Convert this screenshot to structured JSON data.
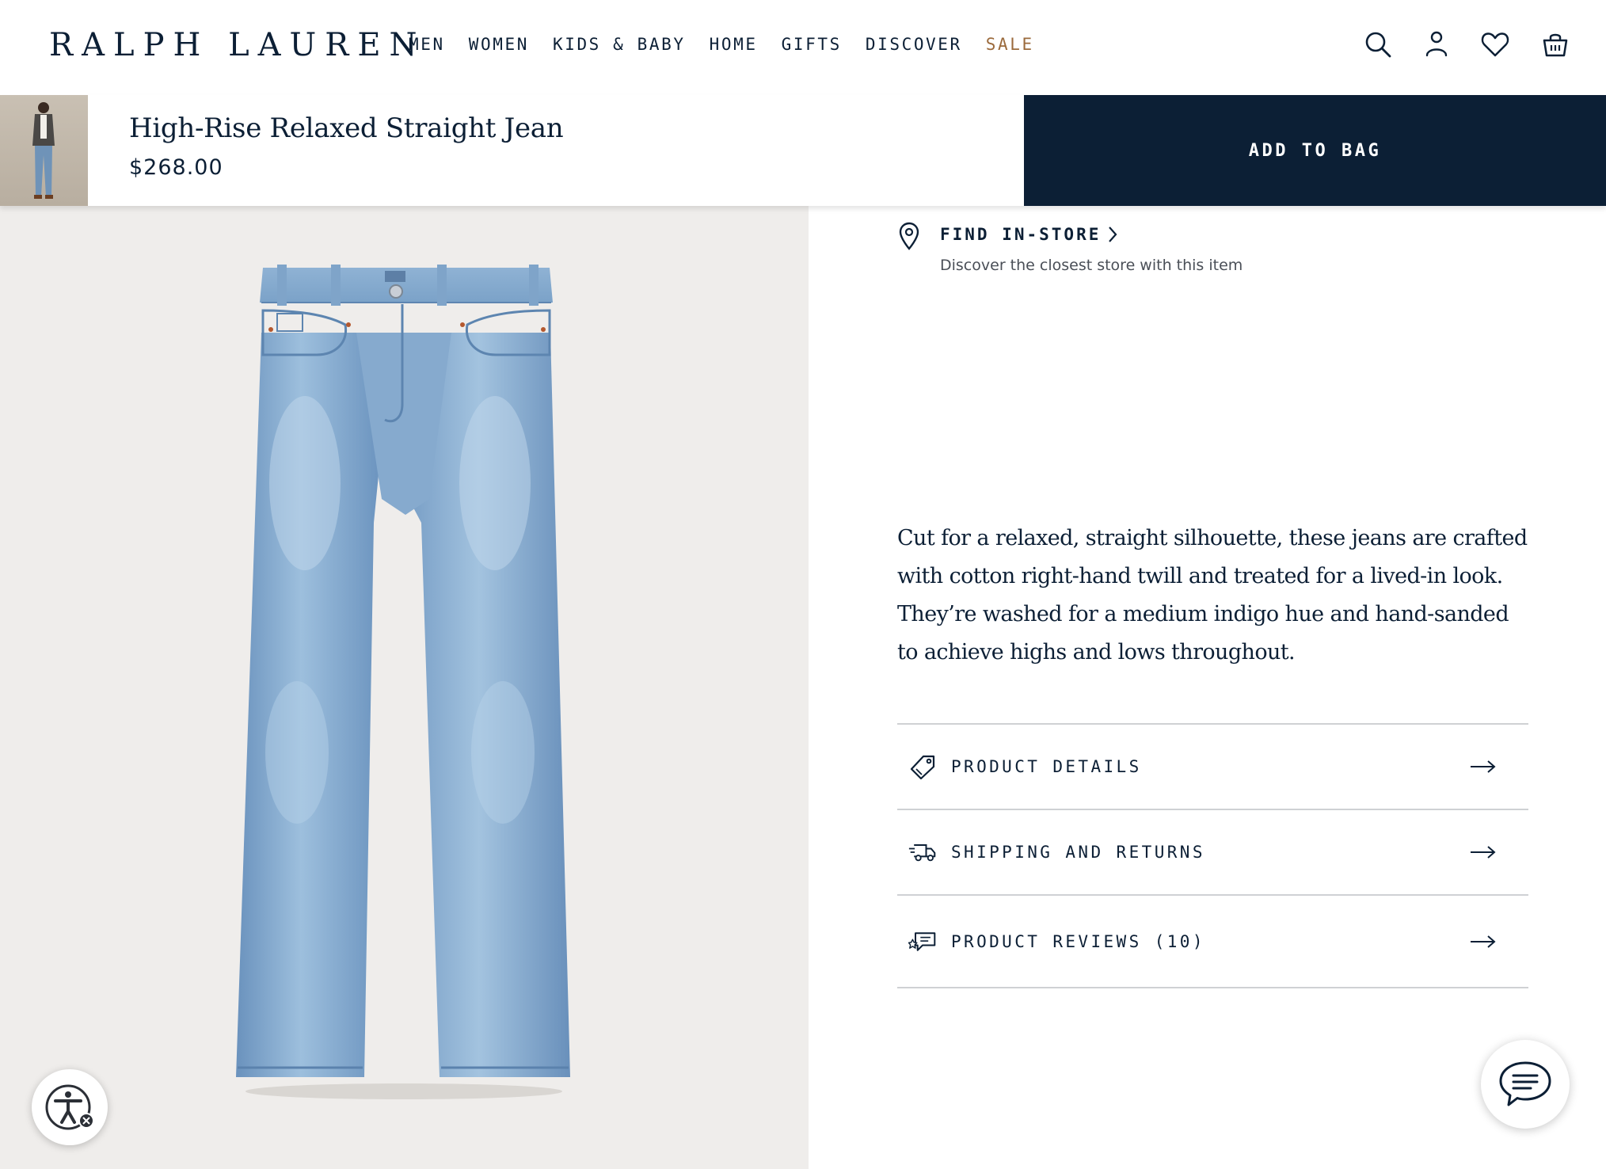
{
  "header": {
    "logo": "RALPH LAUREN",
    "nav": [
      {
        "label": "MEN"
      },
      {
        "label": "WOMEN"
      },
      {
        "label": "KIDS & BABY"
      },
      {
        "label": "HOME"
      },
      {
        "label": "GIFTS"
      },
      {
        "label": "DISCOVER"
      },
      {
        "label": "SALE",
        "color": "#9b6a3c"
      }
    ],
    "icons": [
      "search-icon",
      "account-icon",
      "wishlist-heart-icon",
      "shopping-bag-icon"
    ]
  },
  "sticky_bar": {
    "title": "High-Rise Relaxed Straight Jean",
    "price": "$268.00",
    "add_to_bag": "ADD TO BAG"
  },
  "find_in_store": {
    "label": "FIND IN-STORE",
    "subtext": "Discover the closest store with this item"
  },
  "description": "Cut for a relaxed, straight silhouette, these jeans are crafted with cotton right-hand twill and treated for a lived-in look. They’re washed for a medium indigo hue and hand-sanded to achieve highs and lows throughout.",
  "accordion": [
    {
      "label": "PRODUCT DETAILS",
      "icon": "tag-icon"
    },
    {
      "label": "SHIPPING AND RETURNS",
      "icon": "delivery-truck-icon"
    },
    {
      "label": "PRODUCT REVIEWS (10)",
      "icon": "review-bubble-icon"
    }
  ],
  "colors": {
    "navy": "#0c1f35",
    "sale": "#9b6a3c",
    "image_bg": "#efedeb",
    "divider": "#cfd1d4"
  }
}
